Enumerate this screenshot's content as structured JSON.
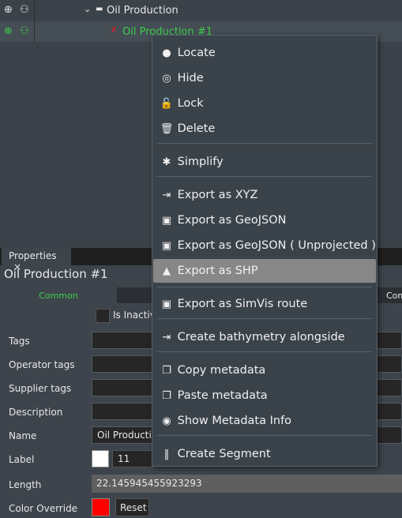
{
  "tree": {
    "items": [
      {
        "label": "Oil Production",
        "icon": "folder-icon"
      },
      {
        "label": "Oil Production #1",
        "icon": "route-icon",
        "color": "#3ecf4e"
      }
    ]
  },
  "menu": {
    "items": [
      {
        "label": "Locate",
        "icon": "pin-icon",
        "glyph": "●"
      },
      {
        "label": "Hide",
        "icon": "eye-off-icon",
        "glyph": "◎"
      },
      {
        "label": "Lock",
        "icon": "lock-icon",
        "glyph": "🔓"
      },
      {
        "label": "Delete",
        "icon": "trash-icon",
        "glyph": "🗑"
      },
      {
        "label": "Simplify",
        "icon": "bug-icon",
        "glyph": "✱"
      },
      {
        "label": "Export as XYZ",
        "icon": "file-export-icon",
        "glyph": "⇥"
      },
      {
        "label": "Export as GeoJSON",
        "icon": "globe-book-icon",
        "glyph": "▣"
      },
      {
        "label": "Export as GeoJSON ( Unprojected )",
        "icon": "globe-book-icon",
        "glyph": "▣"
      },
      {
        "label": "Export as SHP",
        "icon": "shapes-icon",
        "glyph": "▲"
      },
      {
        "label": "Export as SimVis route",
        "icon": "globe-book-icon",
        "glyph": "▣"
      },
      {
        "label": "Create bathymetry alongside",
        "icon": "file-import-icon",
        "glyph": "⇥"
      },
      {
        "label": "Copy metadata",
        "icon": "copy-icon",
        "glyph": "❐"
      },
      {
        "label": "Paste metadata",
        "icon": "paste-icon",
        "glyph": "❐"
      },
      {
        "label": "Show Metadata Info",
        "icon": "eye-icon",
        "glyph": "◉"
      },
      {
        "label": "Create Segment",
        "icon": "segment-icon",
        "glyph": "‖"
      }
    ]
  },
  "properties": {
    "tab": "Properties",
    "title": "Oil Production #1",
    "tabs": [
      "Common",
      "Com"
    ],
    "is_inactive": "Is Inactiv",
    "fields": {
      "tags": "Tags",
      "operator_tags": "Operator tags",
      "supplier_tags": "Supplier tags",
      "description": "Description",
      "name": "Name",
      "name_value": "Oil Productio",
      "label": "Label",
      "label_size": "11",
      "length": "Length",
      "length_value": "22.145945455923293",
      "color_override": "Color Override",
      "reset": "Reset"
    },
    "override_color": "#ff0000"
  }
}
